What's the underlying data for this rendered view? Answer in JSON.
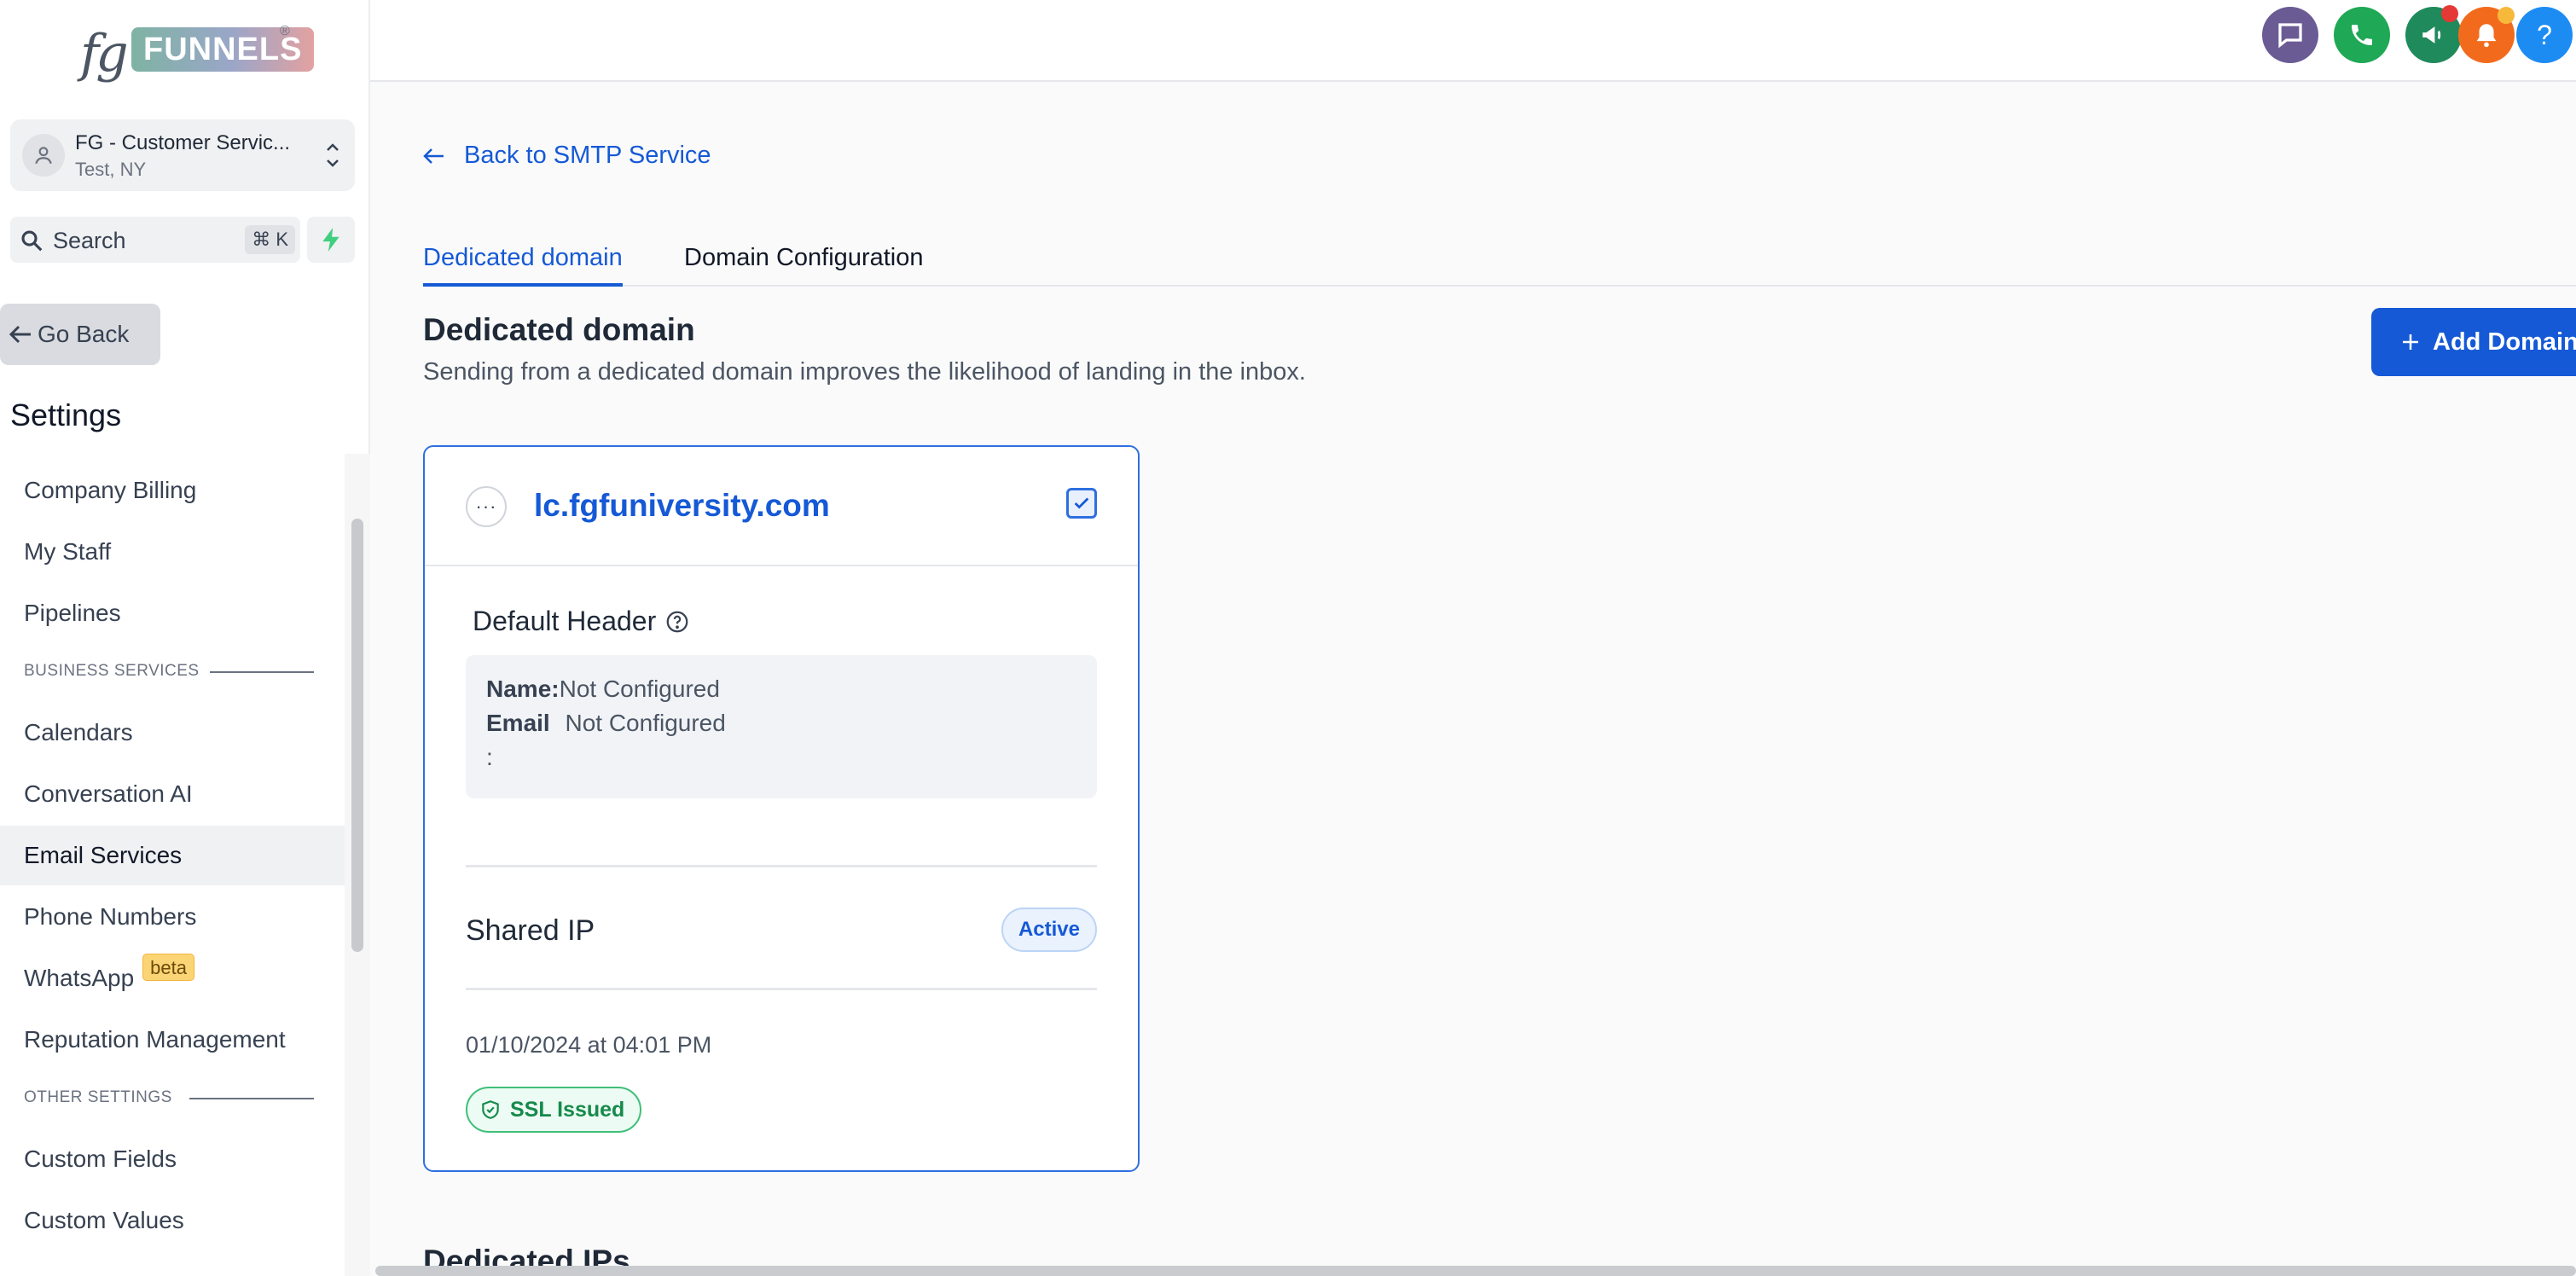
{
  "brand": {
    "logo_text": "FUNNELS",
    "logo_prefix": "fg",
    "registered": "®"
  },
  "account": {
    "name": "FG - Customer Servic...",
    "location": "Test, NY"
  },
  "search": {
    "label": "Search",
    "shortcut": "⌘ K"
  },
  "sidebar": {
    "go_back": "Go Back",
    "settings_title": "Settings",
    "items": [
      {
        "label": "Company Billing"
      },
      {
        "label": "My Staff"
      },
      {
        "label": "Pipelines"
      },
      {
        "section": "BUSINESS SERVICES"
      },
      {
        "label": "Calendars"
      },
      {
        "label": "Conversation AI"
      },
      {
        "label": "Email Services",
        "active": true
      },
      {
        "label": "Phone Numbers"
      },
      {
        "label": "WhatsApp",
        "badge": "beta"
      },
      {
        "label": "Reputation Management"
      },
      {
        "section": "OTHER SETTINGS"
      },
      {
        "label": "Custom Fields"
      },
      {
        "label": "Custom Values"
      }
    ]
  },
  "header": {
    "icons": [
      "chat-icon",
      "phone-icon",
      "megaphone-icon",
      "bell-icon",
      "help-icon"
    ],
    "help_glyph": "?"
  },
  "main": {
    "back_link": "Back to SMTP Service",
    "tabs": [
      {
        "label": "Dedicated domain",
        "active": true
      },
      {
        "label": "Domain Configuration",
        "active": false
      }
    ],
    "section_title": "Dedicated domain",
    "section_subtitle": "Sending from a dedicated domain improves the likelihood of landing in the inbox.",
    "add_button": "Add Domain",
    "card": {
      "more_glyph": "···",
      "domain": "lc.fgfuniversity.com",
      "default_header_title": "Default Header",
      "name_label": "Name:",
      "name_value": "Not Configured",
      "email_label": "Email",
      "email_colon": ":",
      "email_value": "Not Configured",
      "ip_label": "Shared IP",
      "ip_status": "Active",
      "date": "01/10/2024 at 04:01 PM",
      "ssl_status": "SSL Issued"
    },
    "next_section_title": "Dedicated IPs"
  },
  "colors": {
    "accent": "#1559d6",
    "chat_btn": "#6b5b95",
    "phone_btn": "#1fa855",
    "megaphone_btn": "#1f8a5b",
    "bell_btn": "#f26b1d",
    "help_btn": "#1d8cf2",
    "ssl_green": "#168a4b"
  }
}
